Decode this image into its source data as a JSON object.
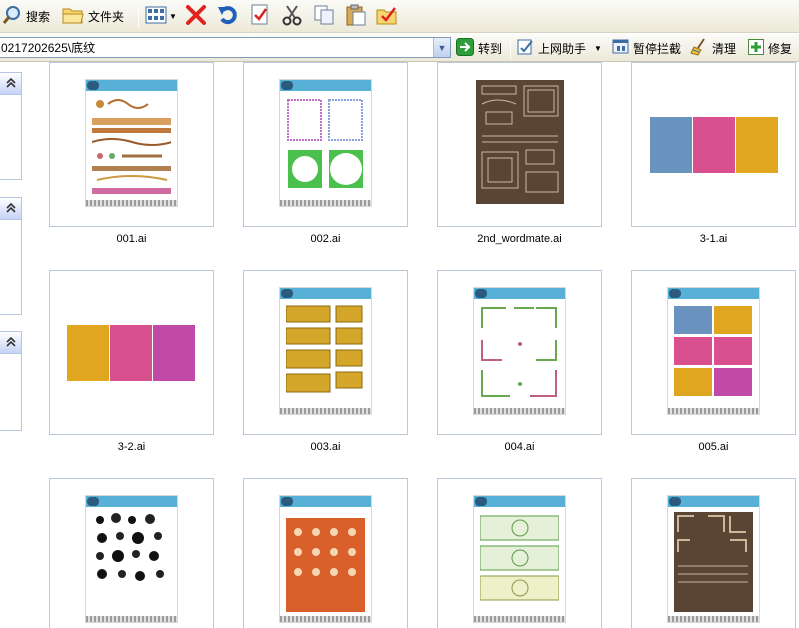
{
  "toolbar": {
    "search_label": "搜索",
    "folders_label": "文件夹"
  },
  "address": {
    "path": "0217202625\\底纹",
    "go_label": "转到",
    "online_helper_label": "上网助手",
    "block_popups_label": "暂停拦截",
    "clean_label": "清理",
    "repair_label": "修复"
  },
  "files": [
    {
      "name": "001.ai",
      "thumb": "sheet-ornaments"
    },
    {
      "name": "002.ai",
      "thumb": "sheet-frames"
    },
    {
      "name": "2nd_wordmate.ai",
      "thumb": "dark-ornaments"
    },
    {
      "name": "3-1.ai",
      "thumb": "swatch-blue-pink-gold"
    },
    {
      "name": "3-2.ai",
      "thumb": "swatch-gold-pink-magenta"
    },
    {
      "name": "003.ai",
      "thumb": "sheet-gold-plates"
    },
    {
      "name": "004.ai",
      "thumb": "sheet-floral-corners"
    },
    {
      "name": "005.ai",
      "thumb": "sheet-swatches"
    },
    {
      "name": "",
      "thumb": "sheet-black-swirls"
    },
    {
      "name": "",
      "thumb": "sheet-orange-pattern"
    },
    {
      "name": "",
      "thumb": "sheet-green-banknote"
    },
    {
      "name": "",
      "thumb": "dark-corners"
    }
  ],
  "colors": {
    "selection_border": "#b9c9d9",
    "header_blue": "#56b0d8",
    "swatch_blue": "#6b93c0",
    "swatch_pink": "#d9508e",
    "swatch_gold": "#e0a61f",
    "swatch_magenta": "#c14aa8",
    "dark_brown": "#5a4535",
    "orange": "#d9602a"
  }
}
